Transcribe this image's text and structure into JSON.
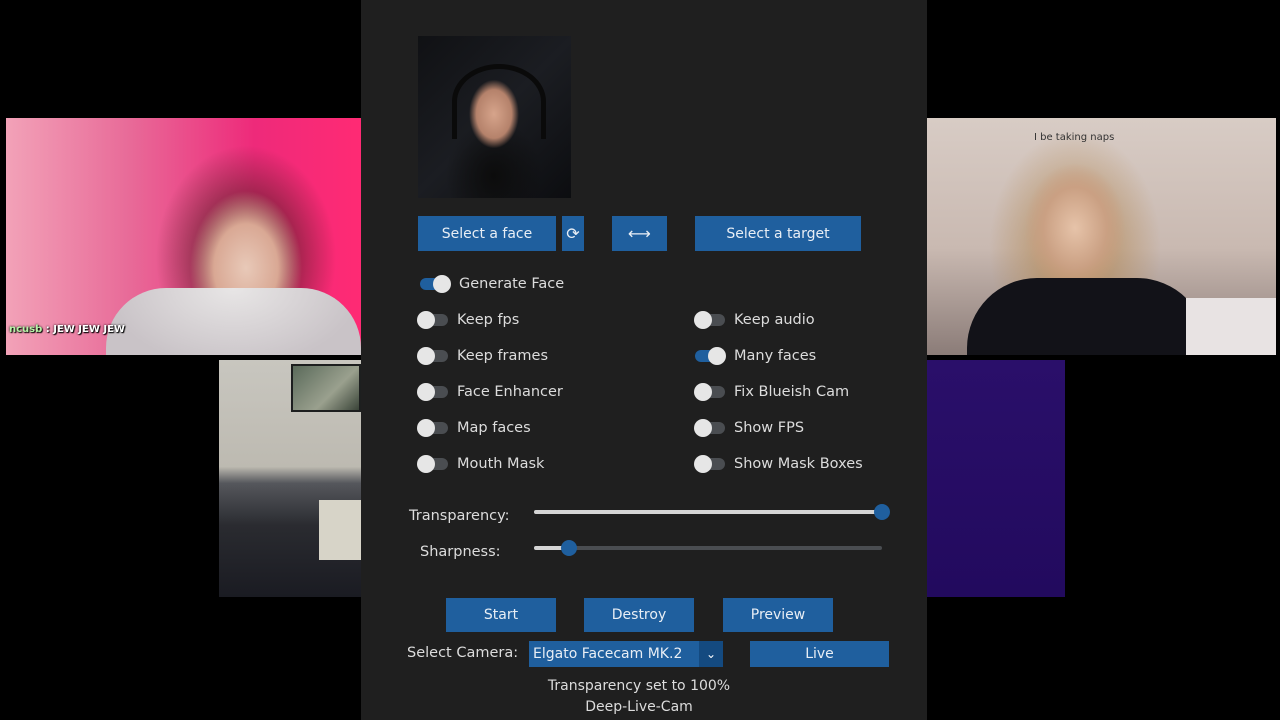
{
  "background": {
    "chat_overlay": {
      "user": "ncusb",
      "message": " : JEW JEW JEW"
    },
    "right_tile_wall_text": "I be taking naps"
  },
  "panel": {
    "buttons": {
      "select_face": "Select a face",
      "refresh_icon": "⟳",
      "swap_icon": "⟷",
      "select_target": "Select a target"
    },
    "toggles": {
      "generate_face": {
        "label": "Generate Face",
        "on": true
      },
      "keep_fps": {
        "label": "Keep fps",
        "on": false
      },
      "keep_audio": {
        "label": "Keep audio",
        "on": false
      },
      "keep_frames": {
        "label": "Keep frames",
        "on": false
      },
      "many_faces": {
        "label": "Many faces",
        "on": true
      },
      "face_enhancer": {
        "label": "Face Enhancer",
        "on": false
      },
      "fix_blueish_cam": {
        "label": "Fix Blueish Cam",
        "on": false
      },
      "map_faces": {
        "label": "Map faces",
        "on": false
      },
      "show_fps": {
        "label": "Show FPS",
        "on": false
      },
      "mouth_mask": {
        "label": "Mouth Mask",
        "on": false
      },
      "show_mask_boxes": {
        "label": "Show Mask Boxes",
        "on": false
      }
    },
    "sliders": {
      "transparency": {
        "label": "Transparency:",
        "value": 1.0
      },
      "sharpness": {
        "label": "Sharpness:",
        "value": 0.1
      }
    },
    "actions": {
      "start": "Start",
      "destroy": "Destroy",
      "preview": "Preview",
      "live": "Live"
    },
    "camera": {
      "label": "Select Camera:",
      "selected": "Elgato Facecam MK.2"
    },
    "status": "Transparency set to 100%",
    "app_title": "Deep-Live-Cam"
  },
  "colors": {
    "panel_bg": "#1f1f1f",
    "accent": "#1f5f9e",
    "text": "#dcdcdc"
  }
}
